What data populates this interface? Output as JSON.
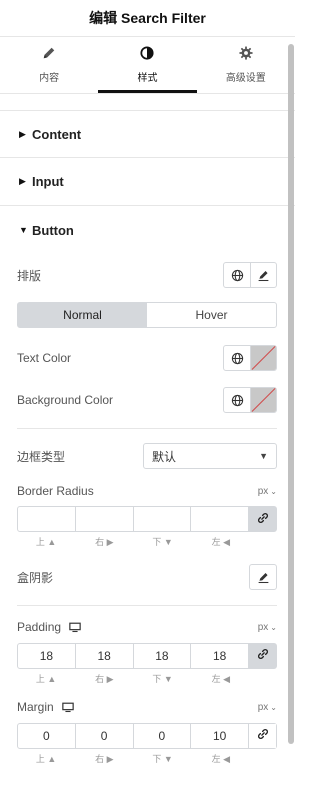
{
  "header": {
    "title": "编辑 Search Filter"
  },
  "tabs": [
    {
      "label": "内容",
      "icon": "pencil-icon"
    },
    {
      "label": "样式",
      "icon": "half-circle-icon",
      "active": true
    },
    {
      "label": "高级设置",
      "icon": "gear-icon"
    }
  ],
  "sections": {
    "content": {
      "title": "Content"
    },
    "input": {
      "title": "Input"
    },
    "button": {
      "title": "Button"
    }
  },
  "button": {
    "typography_label": "排版",
    "state_tabs": {
      "normal": "Normal",
      "hover": "Hover",
      "active": "Normal"
    },
    "text_color_label": "Text Color",
    "background_color_label": "Background Color",
    "border_type_label": "边框类型",
    "border_type_value": "默认",
    "border_radius_label": "Border Radius",
    "border_radius_unit": "px",
    "border_radius_values": [
      "",
      "",
      "",
      ""
    ],
    "box_shadow_label": "盒阴影",
    "padding_label": "Padding",
    "padding_unit": "px",
    "padding_values": [
      "18",
      "18",
      "18",
      "18"
    ],
    "margin_label": "Margin",
    "margin_unit": "px",
    "margin_values": [
      "0",
      "0",
      "0",
      "10"
    ],
    "dim_labels": [
      "上 ▲",
      "右 ▶",
      "下 ▼",
      "左 ◀"
    ]
  },
  "colors": {
    "accent": "#111111",
    "border": "#d5d8dc",
    "unset_slash": "#d14b4b"
  }
}
